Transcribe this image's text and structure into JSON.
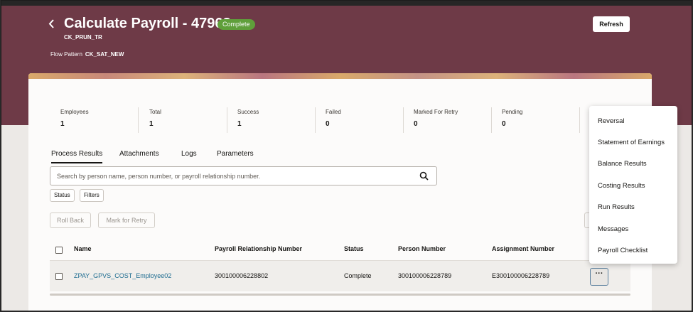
{
  "header": {
    "title": "Calculate Payroll - 47968",
    "status_badge": "Complete",
    "subtitle": "CK_PRUN_TR",
    "flow_pattern_label": "Flow Pattern",
    "flow_pattern_value": "CK_SAT_NEW",
    "refresh_label": "Refresh",
    "back_icon": "chevron-left-icon"
  },
  "metrics": [
    {
      "label": "Employees",
      "value": "1"
    },
    {
      "label": "Total",
      "value": "1"
    },
    {
      "label": "Success",
      "value": "1"
    },
    {
      "label": "Failed",
      "value": "0"
    },
    {
      "label": "Marked For Retry",
      "value": "0"
    },
    {
      "label": "Pending",
      "value": "0"
    }
  ],
  "tabs": [
    {
      "label": "Process Results",
      "active": true
    },
    {
      "label": "Attachments"
    },
    {
      "label": "Logs"
    },
    {
      "label": "Parameters"
    }
  ],
  "search": {
    "placeholder": "Search by person name, person number, or payroll relationship number.",
    "value": "",
    "icon": "search-icon"
  },
  "filters": {
    "status": "Status",
    "filters": "Filters"
  },
  "actions": {
    "roll_back": "Roll Back",
    "mark_for_retry": "Mark for Retry"
  },
  "table": {
    "columns": [
      "Name",
      "Payroll Relationship Number",
      "Status",
      "Person Number",
      "Assignment Number"
    ],
    "rows": [
      {
        "name": "ZPAY_GPVS_COST_Employee02",
        "payroll_relationship_number": "300100006228802",
        "status": "Complete",
        "person_number": "300100006228789",
        "assignment_number": "E300100006228789",
        "more": "···"
      }
    ]
  },
  "menu": {
    "items": [
      "Reversal",
      "Statement of Earnings",
      "Balance Results",
      "Costing Results",
      "Run Results",
      "Messages",
      "Payroll Checklist"
    ]
  },
  "colors": {
    "banner": "#6e3a47",
    "badge": "#5f9f3a",
    "link": "#1f6d91"
  }
}
